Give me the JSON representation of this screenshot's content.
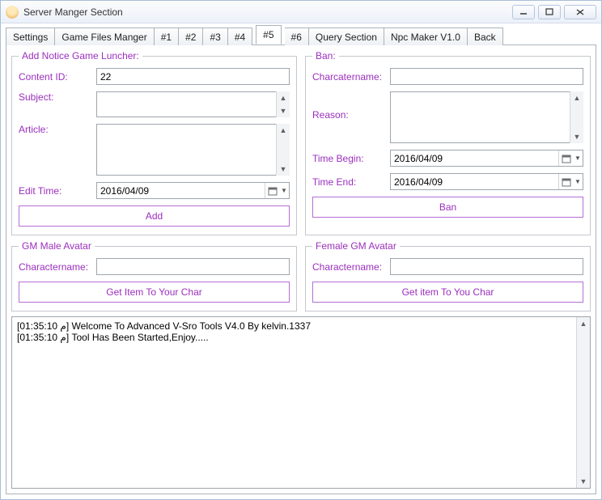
{
  "window": {
    "title": "Server Manger Section"
  },
  "tabs": {
    "settings": "Settings",
    "gamefiles": "Game Files Manger",
    "n1": "#1",
    "n2": "#2",
    "n3": "#3",
    "n4": "#4",
    "n5": "#5",
    "n6": "#6",
    "query": "Query Section",
    "npc": "Npc Maker V1.0",
    "back": "Back"
  },
  "notice": {
    "legend": "Add Notice Game Luncher:",
    "content_id_label": "Content ID:",
    "content_id_value": "22",
    "subject_label": "Subject:",
    "subject_value": "",
    "article_label": "Article:",
    "article_value": "",
    "edit_time_label": "Edit Time:",
    "edit_time_value": "2016/04/09",
    "add_btn": "Add"
  },
  "ban": {
    "legend": "Ban:",
    "charname_label": "Charcatername:",
    "charname_value": "",
    "reason_label": "Reason:",
    "reason_value": "",
    "time_begin_label": "Time Begin:",
    "time_begin_value": "2016/04/09",
    "time_end_label": "Time End:",
    "time_end_value": "2016/04/09",
    "ban_btn": "Ban"
  },
  "gmmale": {
    "legend": "GM Male Avatar",
    "charname_label": "Charactername:",
    "charname_value": "",
    "btn": "Get Item To Your Char"
  },
  "gmfemale": {
    "legend": "Female GM Avatar",
    "charname_label": "Charactername:",
    "charname_value": "",
    "btn": "Get item To You Char"
  },
  "log": {
    "lines": [
      "[01:35:10 م] Welcome To Advanced V-Sro Tools V4.0 By kelvin.1337",
      "[01:35:10 م] Tool Has Been Started,Enjoy....."
    ]
  }
}
